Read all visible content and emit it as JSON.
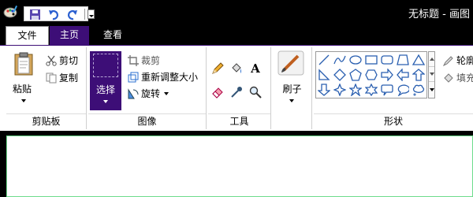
{
  "window": {
    "title": "无标题 - 画图"
  },
  "tabs": {
    "file": "文件",
    "home": "主页",
    "view": "查看"
  },
  "clipboard": {
    "paste": "粘贴",
    "cut": "剪切",
    "copy": "复制",
    "label": "剪贴板"
  },
  "image": {
    "select": "选择",
    "crop": "裁剪",
    "resize": "重新调整大小",
    "rotate": "旋转",
    "label": "图像"
  },
  "tools": {
    "label": "工具",
    "text_glyph": "A"
  },
  "brushes": {
    "label": "刷子"
  },
  "shapes": {
    "label": "形状",
    "outline": "轮廓",
    "fill": "填充"
  },
  "colors": {
    "accent": "#3d0e77",
    "canvas_border": "#6ddc8c"
  }
}
